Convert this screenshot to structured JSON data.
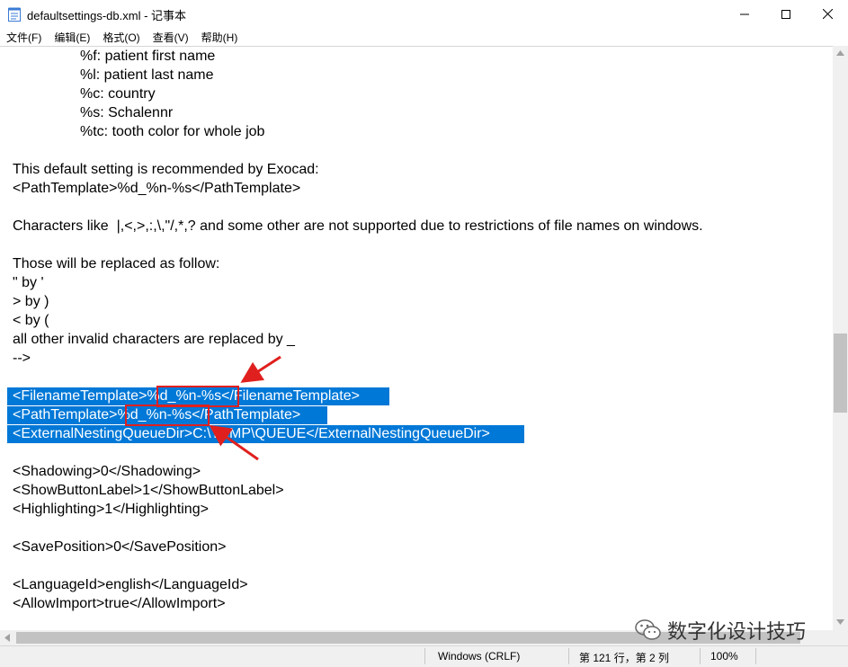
{
  "window": {
    "title": "defaultsettings-db.xml - 记事本",
    "minimize_icon": "minimize-icon",
    "maximize_icon": "maximize-icon",
    "close_icon": "close-icon"
  },
  "menu": [
    {
      "label": "文件(F)"
    },
    {
      "label": "编辑(E)"
    },
    {
      "label": "格式(O)"
    },
    {
      "label": "查看(V)"
    },
    {
      "label": "帮助(H)"
    }
  ],
  "editor": {
    "lines": [
      "%f: patient first name",
      "%l: patient last name",
      "%c: country",
      "%s: Schalennr",
      "%tc: tooth color for whole job",
      "This default setting is recommended by Exocad:",
      "<PathTemplate>%d_%n-%s</PathTemplate>",
      "Characters like  |,<,>,:,\\,\"/,*,? and some other are not supported due to restrictions of file names on windows.",
      "Those will be replaced as follow:",
      "\" by '",
      "> by )",
      "< by (",
      "all other invalid characters are replaced by _",
      "-->",
      "<FilenameTemplate>%d_%n-%s</FilenameTemplate>",
      "<PathTemplate>%d_%n-%s</PathTemplate>",
      "<ExternalNestingQueueDir>C:\\TEMP\\QUEUE</ExternalNestingQueueDir>",
      "<Shadowing>0</Shadowing>",
      "<ShowButtonLabel>1</ShowButtonLabel>",
      "<Highlighting>1</Highlighting>",
      "<SavePosition>0</SavePosition>",
      "<LanguageId>english</LanguageId>",
      "<AllowImport>true</AllowImport>"
    ]
  },
  "status": {
    "encoding": "Windows (CRLF)",
    "position": "第 121 行，第 2 列",
    "zoom": "100%"
  },
  "watermark": {
    "text": "数字化设计技巧",
    "icon": "wechat-icon"
  },
  "colors": {
    "selection": "#0078d7",
    "annotation": "#e0201e"
  }
}
